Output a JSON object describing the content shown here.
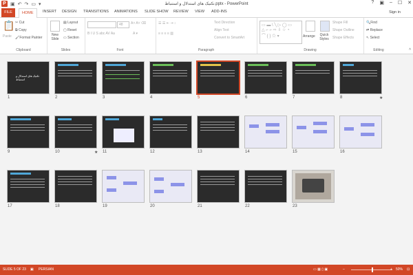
{
  "window": {
    "title": "تکنیک های استدلال و استنباط.pptx - PowerPoint",
    "sign_in": "Sign in",
    "app_icon": "P"
  },
  "tabs": [
    "FILE",
    "HOME",
    "INSERT",
    "DESIGN",
    "TRANSITIONS",
    "ANIMATIONS",
    "SLIDE SHOW",
    "REVIEW",
    "VIEW",
    "ADD-INS"
  ],
  "active_tab": "HOME",
  "ribbon": {
    "clipboard": {
      "paste": "Paste",
      "cut": "Cut",
      "copy": "Copy",
      "format_painter": "Format Painter",
      "label": "Clipboard"
    },
    "slides": {
      "new_slide": "New Slide",
      "layout": "Layout",
      "reset": "Reset",
      "section": "Section",
      "label": "Slides"
    },
    "font": {
      "size": "48",
      "label": "Font"
    },
    "paragraph": {
      "text_direction": "Text Direction",
      "align_text": "Align Text",
      "smartart": "Convert to SmartArt",
      "label": "Paragraph"
    },
    "drawing": {
      "arrange": "Arrange",
      "quick_styles": "Quick Styles",
      "shape_fill": "Shape Fill",
      "shape_outline": "Shape Outline",
      "shape_effects": "Shape Effects",
      "label": "Drawing"
    },
    "editing": {
      "find": "Find",
      "replace": "Replace",
      "select": "Select",
      "label": "Editing"
    }
  },
  "slides": [
    {
      "n": "1",
      "star": ""
    },
    {
      "n": "2",
      "star": ""
    },
    {
      "n": "3",
      "star": ""
    },
    {
      "n": "4",
      "star": ""
    },
    {
      "n": "5",
      "star": "",
      "selected": true
    },
    {
      "n": "6",
      "star": ""
    },
    {
      "n": "7",
      "star": ""
    },
    {
      "n": "8",
      "star": "★"
    },
    {
      "n": "9",
      "star": ""
    },
    {
      "n": "10",
      "star": "★"
    },
    {
      "n": "11",
      "star": ""
    },
    {
      "n": "12",
      "star": ""
    },
    {
      "n": "13",
      "star": ""
    },
    {
      "n": "14",
      "star": ""
    },
    {
      "n": "15",
      "star": ""
    },
    {
      "n": "16",
      "star": ""
    },
    {
      "n": "17",
      "star": ""
    },
    {
      "n": "18",
      "star": ""
    },
    {
      "n": "19",
      "star": ""
    },
    {
      "n": "20",
      "star": ""
    },
    {
      "n": "21",
      "star": ""
    },
    {
      "n": "22",
      "star": ""
    },
    {
      "n": "23",
      "star": ""
    }
  ],
  "slide1_title": "تکنیک های استدلال و استنباط",
  "status": {
    "slide_of": "SLIDE 5 OF 23",
    "language": "PERSIAN",
    "zoom": "50%"
  },
  "colors": {
    "accent": "#d24726"
  }
}
